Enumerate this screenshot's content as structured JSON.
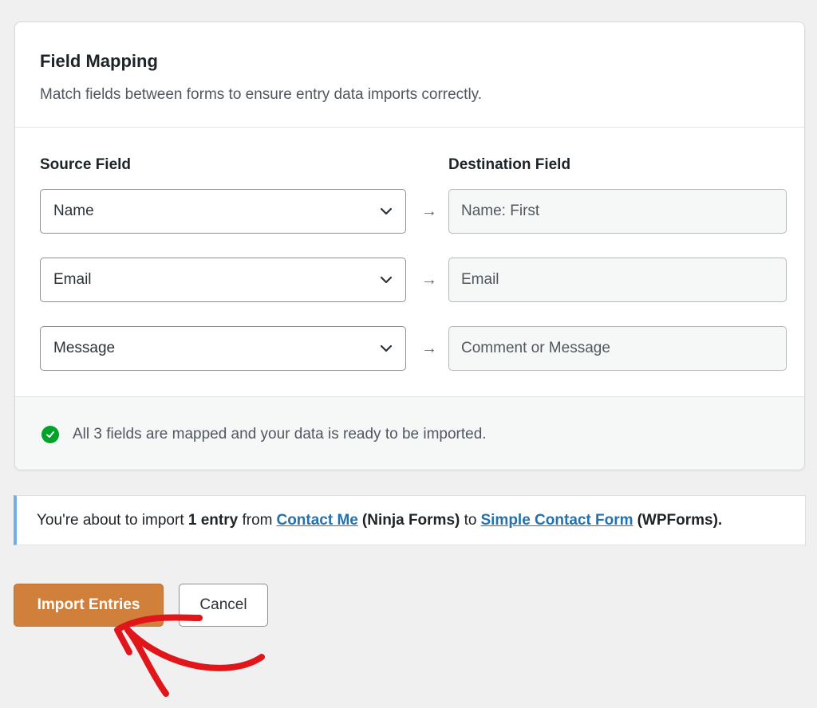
{
  "field_mapping": {
    "title": "Field Mapping",
    "description": "Match fields between forms to ensure entry data imports correctly.",
    "source_header": "Source Field",
    "destination_header": "Destination Field",
    "arrow_glyph": "→",
    "rows": [
      {
        "source": "Name",
        "destination": "Name: First"
      },
      {
        "source": "Email",
        "destination": "Email"
      },
      {
        "source": "Message",
        "destination": "Comment or Message"
      }
    ],
    "status_text": "All 3 fields are mapped and your data is ready to be imported.",
    "status_icon": "check-circle-icon",
    "status_color": "#00a32a"
  },
  "notice": {
    "prefix": "You're about to import",
    "count": "1 entry",
    "from_word": "from",
    "source_form": "Contact Me",
    "source_plugin": "(Ninja Forms)",
    "to_word": "to",
    "dest_form": "Simple Contact Form",
    "dest_plugin": "(WPForms).",
    "accent_color": "#72aee6"
  },
  "actions": {
    "import_label": "Import Entries",
    "cancel_label": "Cancel",
    "import_color": "#d1803b"
  },
  "annotation": {
    "icon": "red-arrow-annotation",
    "color": "#e0161b"
  }
}
